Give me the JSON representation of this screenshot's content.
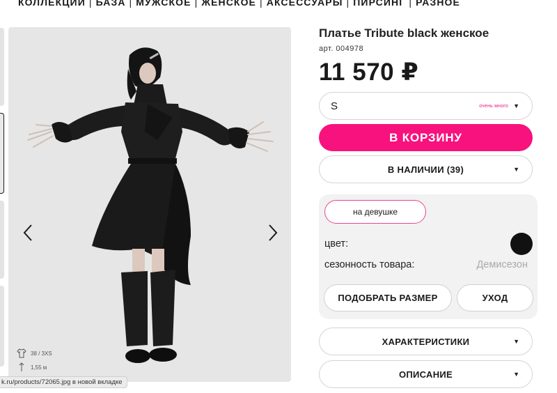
{
  "nav": {
    "items": [
      "КОЛЛЕКЦИИ",
      "БАЗА",
      "МУЖСКОЕ",
      "ЖЕНСКОЕ",
      "АКСЕССУАРЫ",
      "ПИРСИНГ",
      "РАЗНОЕ"
    ],
    "separator": "|"
  },
  "gallery": {
    "prev_icon": "chevron-left-icon",
    "next_icon": "chevron-right-icon",
    "model_size": "38 / 3XS",
    "model_height": "1,55 м"
  },
  "status_bar": {
    "text": "k.ru/products/72065.jpg в новой вкладке"
  },
  "product": {
    "title": "Платье Tribute black женское",
    "sku": "арт. 004978",
    "price": "11 570 ₽",
    "size": {
      "selected": "S",
      "stock_note": "очень много"
    },
    "cart_button": "В КОРЗИНУ",
    "availability": "В НАЛИЧИИ (39)",
    "details": {
      "tag_button": "на девушке",
      "color_label": "цвет:",
      "color_value": "#111111",
      "season_label": "сезонность товара:",
      "season_value": "Демисезон",
      "fit_button": "ПОДОБРАТЬ РАЗМЕР",
      "care_button": "УХОД"
    },
    "specs_label": "ХАРАКТЕРИСТИКИ",
    "description_label": "ОПИСАНИЕ"
  },
  "colors": {
    "accent": "#f8127d",
    "tag_border": "#e6478f",
    "stock_note": "#e8197f"
  }
}
